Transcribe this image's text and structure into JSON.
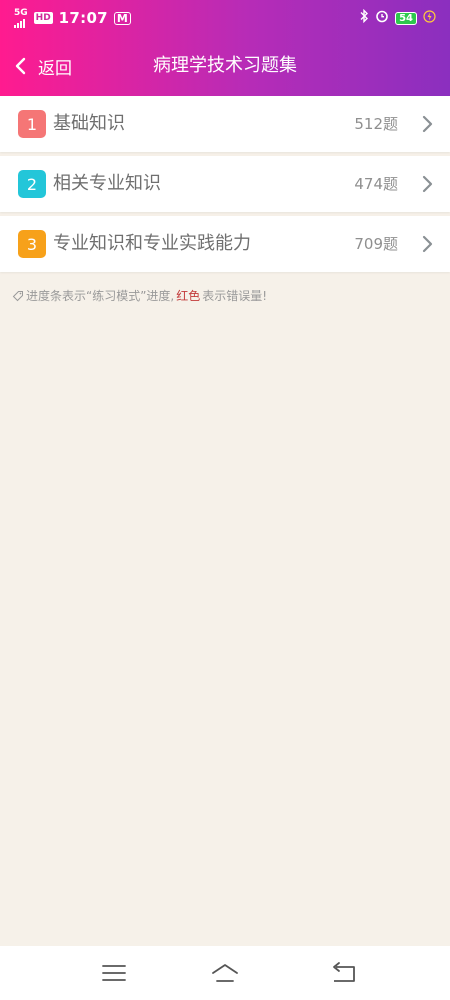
{
  "status": {
    "network": "5G",
    "hd": "HD",
    "time": "17:07",
    "app_badge": "M",
    "battery": "54"
  },
  "header": {
    "back_label": "返回",
    "title": "病理学技术习题集"
  },
  "items": [
    {
      "index": "1",
      "title": "基础知识",
      "count": "512题",
      "color": "#f57676"
    },
    {
      "index": "2",
      "title": "相关专业知识",
      "count": "474题",
      "color": "#23c6d9"
    },
    {
      "index": "3",
      "title": "专业知识和专业实践能力",
      "count": "709题",
      "color": "#f7a11a"
    }
  ],
  "hint": {
    "text_before": "进度条表示“练习模式”进度,",
    "red_word": "红色",
    "text_after": "表示错误量!"
  },
  "colors": {
    "header_start": "#ff1b8f",
    "header_end": "#8b2fbf",
    "background": "#f6f1e9"
  }
}
